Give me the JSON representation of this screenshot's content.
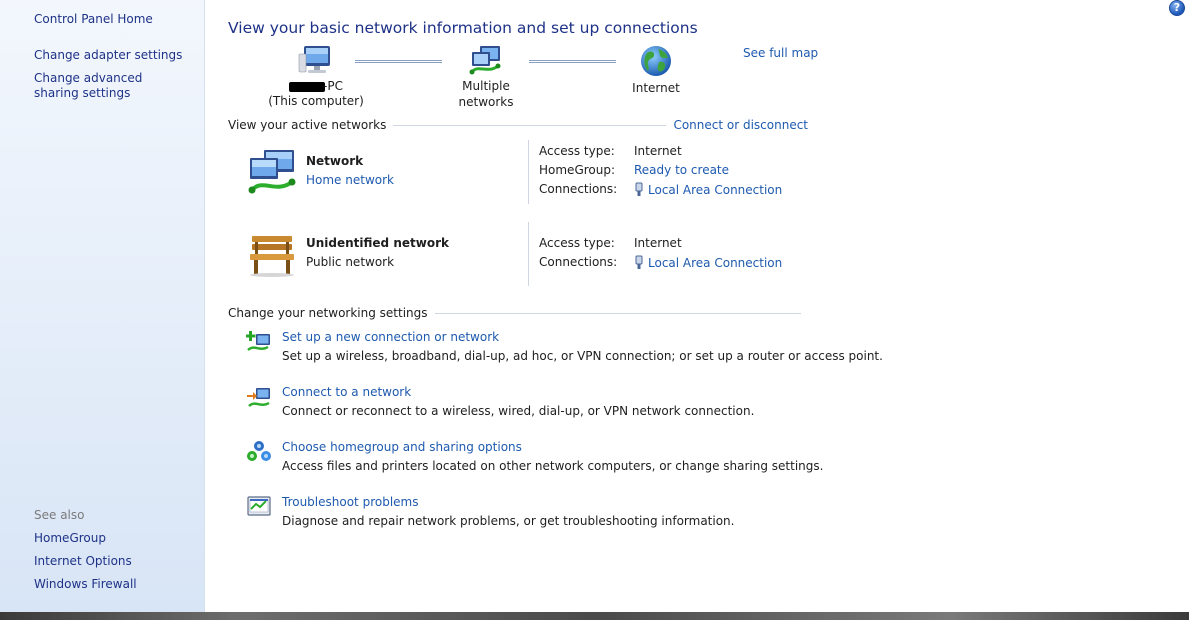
{
  "left_nav": {
    "home": "Control Panel Home",
    "adapter": "Change adapter settings",
    "advanced_sharing": "Change advanced sharing settings",
    "see_also": "See also",
    "see_also_items": [
      "HomeGroup",
      "Internet Options",
      "Windows Firewall"
    ]
  },
  "help": {
    "glyph": "?"
  },
  "main": {
    "title": "View your basic network information and set up connections",
    "see_full_map": "See full map",
    "map": {
      "computer_suffix": "-PC",
      "computer_sub": "(This computer)",
      "middle": "Multiple networks",
      "internet": "Internet"
    },
    "active_networks_header": "View your active networks",
    "connect_or_disconnect": "Connect or disconnect",
    "networks": [
      {
        "name": "Network",
        "type": "Home network",
        "icon": "network-icon",
        "props": [
          {
            "label": "Access type:",
            "value": "Internet",
            "link": false
          },
          {
            "label": "HomeGroup:",
            "value": "Ready to create",
            "link": true
          },
          {
            "label": "Connections:",
            "value": "Local Area Connection",
            "link": true
          }
        ]
      },
      {
        "name": "Unidentified network",
        "type": "Public network",
        "icon": "park-bench-icon",
        "props": [
          {
            "label": "Access type:",
            "value": "Internet",
            "link": false
          },
          {
            "label": "Connections:",
            "value": "Local Area Connection",
            "link": true
          }
        ]
      }
    ],
    "settings_header": "Change your networking settings",
    "tasks": [
      {
        "title": "Set up a new connection or network",
        "desc": "Set up a wireless, broadband, dial-up, ad hoc, or VPN connection; or set up a router or access point."
      },
      {
        "title": "Connect to a network",
        "desc": "Connect or reconnect to a wireless, wired, dial-up, or VPN network connection."
      },
      {
        "title": "Choose homegroup and sharing options",
        "desc": "Access files and printers located on other network computers, or change sharing settings."
      },
      {
        "title": "Troubleshoot problems",
        "desc": "Diagnose and repair network problems, or get troubleshooting information."
      }
    ]
  },
  "colors": {
    "link": "#1e5aaf",
    "title": "#1e3287",
    "nav_bg": "#e4edf9"
  }
}
